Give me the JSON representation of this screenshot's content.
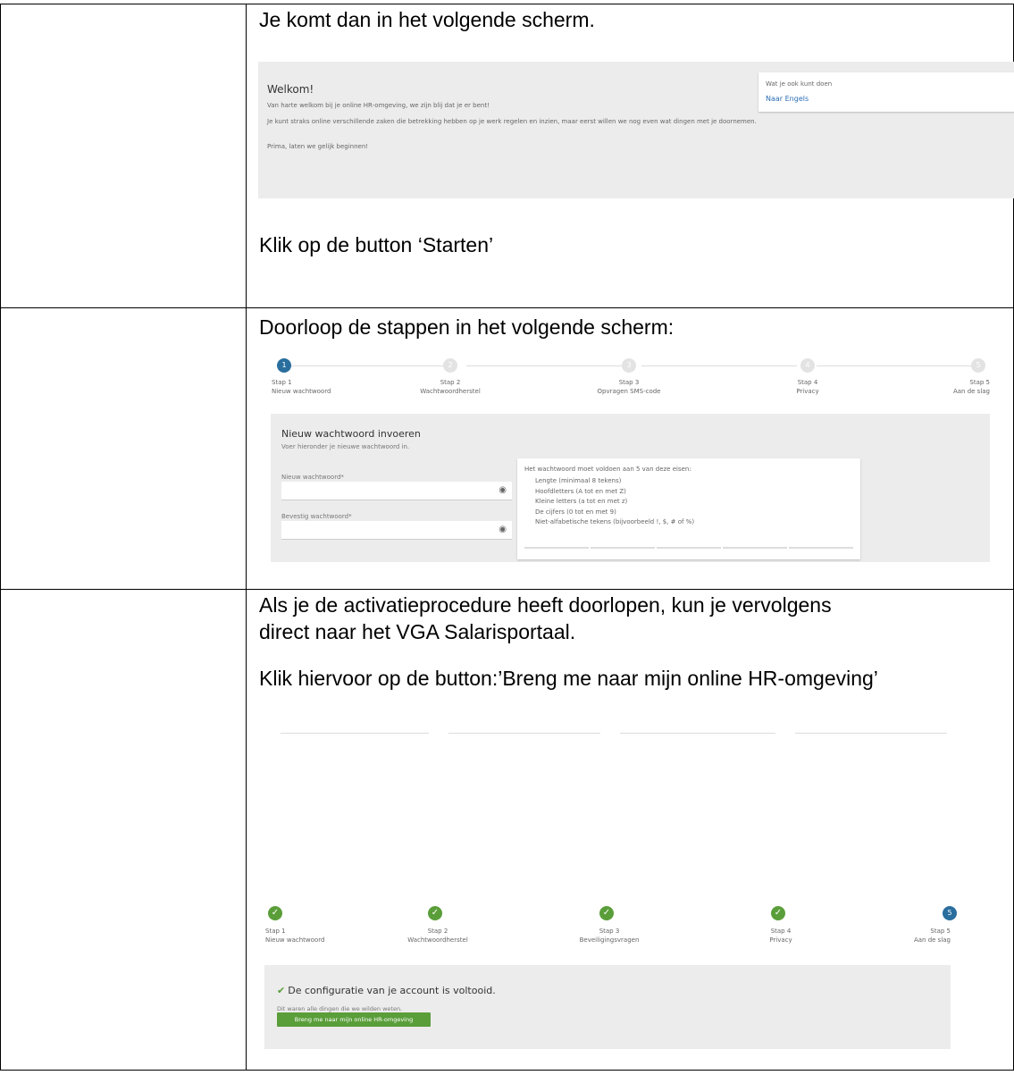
{
  "row1": {
    "intro": "Je komt dan in het volgende scherm.",
    "welcome": {
      "title": "Welkom!",
      "line1": "Van harte welkom bij je online HR-omgeving, we zijn blij dat je er bent!",
      "line2": "Je kunt straks online verschillende zaken die betrekking hebben op je werk regelen en inzien, maar eerst willen we nog even wat dingen met je doornemen.",
      "line3": "Prima, laten we gelijk beginnen!",
      "side_title": "Wat je ook kunt doen",
      "side_link": "Naar Engels"
    },
    "instruction": "Klik op de button ‘Starten’"
  },
  "row2": {
    "intro": "Doorloop de stappen in het volgende scherm:",
    "steps": [
      {
        "n": "1",
        "step": "Stap 1",
        "name": "Nieuw wachtwoord"
      },
      {
        "n": "2",
        "step": "Stap 2",
        "name": "Wachtwoordherstel"
      },
      {
        "n": "3",
        "step": "Stap 3",
        "name": "Opvragen SMS-code"
      },
      {
        "n": "4",
        "step": "Stap 4",
        "name": "Privacy"
      },
      {
        "n": "5",
        "step": "Stap 5",
        "name": "Aan de slag"
      }
    ],
    "panel": {
      "title": "Nieuw wachtwoord invoeren",
      "subtitle": "Voer hieronder je nieuwe wachtwoord in.",
      "new_label": "Nieuw wachtwoord*",
      "confirm_label": "Bevestig wachtwoord*",
      "req_title": "Het wachtwoord moet voldoen aan 5 van deze eisen:",
      "requirements": [
        "Lengte (minimaal 8 tekens)",
        "Hoofdletters (A tot en met Z)",
        "Kleine letters (a tot en met z)",
        "De cijfers (0 tot en met 9)",
        "Niet-alfabetische tekens (bijvoorbeeld !, $, # of %)"
      ]
    }
  },
  "row3": {
    "para1_line1": "Als je de activatieprocedure heeft doorlopen, kun je vervolgens",
    "para1_line2": "direct naar het VGA Salarisportaal.",
    "para2": "Klik hiervoor op de button:’Breng me naar mijn online HR-omgeving’",
    "steps": [
      {
        "n": "✓",
        "step": "Stap 1",
        "name": "Nieuw wachtwoord"
      },
      {
        "n": "✓",
        "step": "Stap 2",
        "name": "Wachtwoordherstel"
      },
      {
        "n": "✓",
        "step": "Stap 3",
        "name": "Beveiligingsvragen"
      },
      {
        "n": "✓",
        "step": "Stap 4",
        "name": "Privacy"
      },
      {
        "n": "5",
        "step": "Stap 5",
        "name": "Aan de slag"
      }
    ],
    "done_title": "De configuratie van je account is voltooid.",
    "done_sub": "Dit waren alle dingen die we wilden weten.",
    "done_button": "Breng me naar mijn online HR-omgeving"
  }
}
